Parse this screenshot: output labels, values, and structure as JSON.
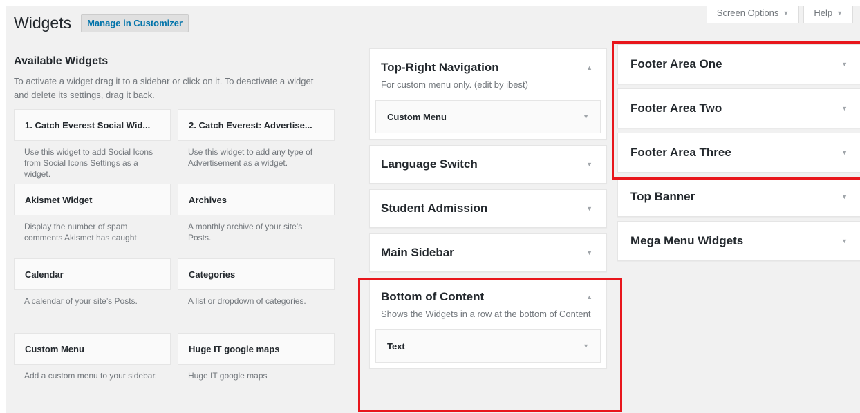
{
  "screen_meta": {
    "screen_options_label": "Screen Options",
    "help_label": "Help"
  },
  "header": {
    "title": "Widgets",
    "manage_label": "Manage in Customizer"
  },
  "available": {
    "heading": "Available Widgets",
    "description": "To activate a widget drag it to a sidebar or click on it. To deactivate a widget and delete its settings, drag it back.",
    "widgets": [
      {
        "title": "1. Catch Everest Social Wid...",
        "desc": "Use this widget to add Social Icons from Social Icons Settings as a widget."
      },
      {
        "title": "2. Catch Everest: Advertise...",
        "desc": "Use this widget to add any type of Advertisement as a widget."
      },
      {
        "title": "Akismet Widget",
        "desc": "Display the number of spam comments Akismet has caught"
      },
      {
        "title": "Archives",
        "desc": "A monthly archive of your site’s Posts."
      },
      {
        "title": "Calendar",
        "desc": "A calendar of your site’s Posts."
      },
      {
        "title": "Categories",
        "desc": "A list or dropdown of categories."
      },
      {
        "title": "Custom Menu",
        "desc": "Add a custom menu to your sidebar."
      },
      {
        "title": "Huge IT google maps",
        "desc": "Huge IT google maps"
      }
    ]
  },
  "sidebars_col2": [
    {
      "name": "Top-Right Navigation",
      "desc": "For custom menu only. (edit by ibest)",
      "widget": "Custom Menu",
      "expanded": true
    },
    {
      "name": "Language Switch"
    },
    {
      "name": "Student Admission"
    },
    {
      "name": "Main Sidebar"
    },
    {
      "name": "Bottom of Content",
      "desc": "Shows the Widgets in a row at the bottom of Content",
      "widget": "Text",
      "expanded": true
    }
  ],
  "sidebars_col3": [
    {
      "name": "Footer Area One"
    },
    {
      "name": "Footer Area Two"
    },
    {
      "name": "Footer Area Three"
    },
    {
      "name": "Top Banner"
    },
    {
      "name": "Mega Menu Widgets"
    }
  ],
  "colors": {
    "highlight": "#e8161c",
    "link": "#0073aa",
    "background": "#f1f1f1"
  },
  "icons": {
    "collapse": "triangle-up-icon",
    "expand": "triangle-down-icon"
  }
}
